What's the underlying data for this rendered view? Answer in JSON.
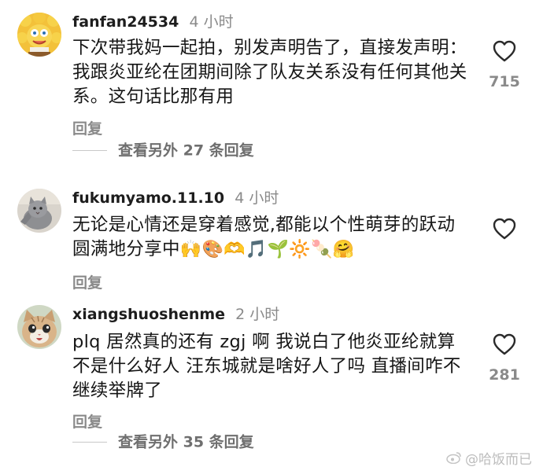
{
  "comments": [
    {
      "username": "fanfan24534",
      "time": "4 小时",
      "text": "下次带我妈一起拍，别发声明告了，直接发声明：我跟炎亚纶在团期间除了队友关系没有任何其他关系。这句话比那有用",
      "emojis": "",
      "reply_label": "回复",
      "likes": "715",
      "more_replies": "查看另外 27 条回复",
      "avatar_icon": "sponge-character-avatar"
    },
    {
      "username": "fukumyamo.11.10",
      "time": "4 小时",
      "text": "无论是心情还是穿着感觉,都能以个性萌芽的跃动圆满地分享中",
      "emojis": "🙌🎨🫶🎵🌱🔆🍡🤗",
      "reply_label": "回复",
      "likes": "",
      "more_replies": "",
      "avatar_icon": "gray-cat-avatar"
    },
    {
      "username": "xiangshuoshenme",
      "time": "2 小时",
      "text": "plq 居然真的还有 zgj 啊 我说白了他炎亚纶就算不是什么好人 汪东城就是啥好人了吗 直播间咋不继续举牌了",
      "emojis": "",
      "reply_label": "回复",
      "likes": "281",
      "more_replies": "查看另外 35 条回复",
      "avatar_icon": "kitten-avatar"
    }
  ],
  "watermark": "@哈饭而已",
  "colors": {
    "text": "#161616",
    "secondary": "#8a8a8a",
    "divider": "#c8c8c8"
  }
}
